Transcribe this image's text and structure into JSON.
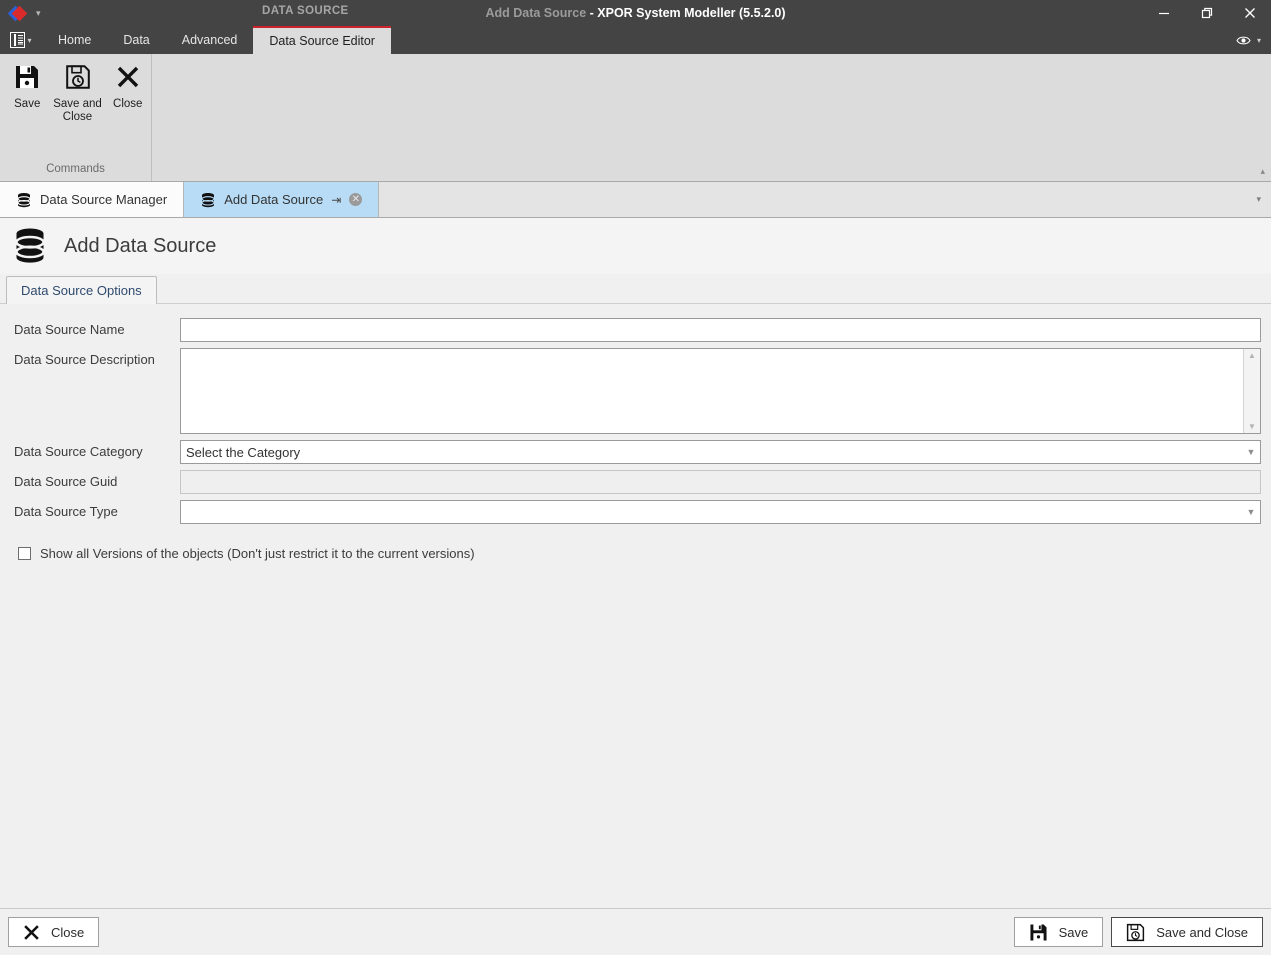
{
  "window": {
    "context_label": "DATA SOURCE",
    "title_document": "Add Data Source",
    "title_app": " - XPOR System Modeller (5.5.2.0)",
    "minimize_label": "Minimize",
    "restore_label": "Restore",
    "close_label": "Close",
    "quick_access_caret": "▾",
    "eye_caret": "▾"
  },
  "ribbon": {
    "file_caret": "▾",
    "tabs": [
      {
        "label": "Home",
        "active": false
      },
      {
        "label": "Data",
        "active": false
      },
      {
        "label": "Advanced",
        "active": false
      },
      {
        "label": "Data Source Editor",
        "active": true
      }
    ],
    "group": {
      "title": "Commands",
      "buttons": [
        {
          "label": "Save",
          "icon": "save-icon"
        },
        {
          "label": "Save and Close",
          "icon": "save-and-close-icon"
        },
        {
          "label": "Close",
          "icon": "close-x-icon"
        }
      ]
    },
    "collapse_caret": "▴"
  },
  "document_tabs": {
    "items": [
      {
        "label": "Data Source Manager",
        "active": false,
        "icon": "database-icon"
      },
      {
        "label": "Add Data Source",
        "active": true,
        "icon": "database-icon",
        "pin": "⇥",
        "close": "✕"
      }
    ],
    "overflow_caret": "▾"
  },
  "page": {
    "title": "Add Data Source",
    "icon": "database-icon"
  },
  "form": {
    "tab_label": "Data Source Options",
    "fields": [
      {
        "label": "Data Source Name",
        "type": "text",
        "value": "",
        "placeholder": "",
        "disabled": false
      },
      {
        "label": "Data Source Description",
        "type": "textarea",
        "value": "",
        "placeholder": "",
        "disabled": false
      },
      {
        "label": "Data Source Category",
        "type": "combo",
        "value": "Select the Category",
        "disabled": false
      },
      {
        "label": "Data Source Guid",
        "type": "text",
        "value": "",
        "placeholder": "",
        "disabled": true
      },
      {
        "label": "Data Source Type",
        "type": "combo",
        "value": "",
        "disabled": false
      }
    ],
    "checkbox": {
      "label": "Show all Versions of the objects (Don't just restrict it to the current versions)",
      "checked": false
    },
    "scroll_up": "▲",
    "scroll_down": "▼",
    "combo_caret": "▼"
  },
  "footer": {
    "close_label": "Close",
    "save_label": "Save",
    "save_and_close_label": "Save and Close"
  },
  "colors": {
    "titlebar": "#444444",
    "ribbon_accent": "#cc2229",
    "active_tab": "#b8dcf5",
    "ribbon_body": "#dcdcdc",
    "content_bg": "#f0f0f0"
  }
}
